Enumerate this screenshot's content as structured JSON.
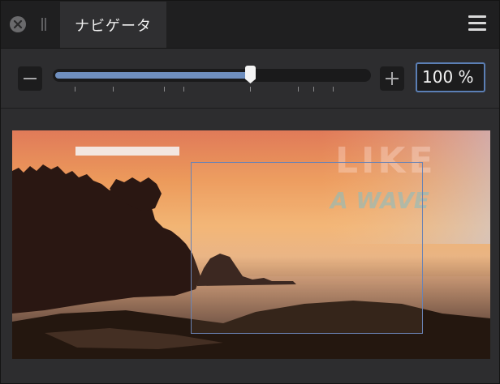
{
  "tab": {
    "title": "ナビゲータ"
  },
  "zoom": {
    "value_text": "100 %",
    "slider_fraction": 0.62,
    "tick_fractions": [
      0.07,
      0.19,
      0.35,
      0.41,
      0.62,
      0.77,
      0.82,
      0.88
    ]
  },
  "preview": {
    "overlay_line1": "LIKE",
    "overlay_line2": "A WAVE"
  },
  "colors": {
    "accent": "#5b7fb5",
    "slider_fill": "#6f8fbf"
  },
  "icons": {
    "close": "close-icon",
    "grip": "grip-icon",
    "menu": "hamburger-menu-icon",
    "zoom_out": "minus-icon",
    "zoom_in": "plus-icon"
  }
}
